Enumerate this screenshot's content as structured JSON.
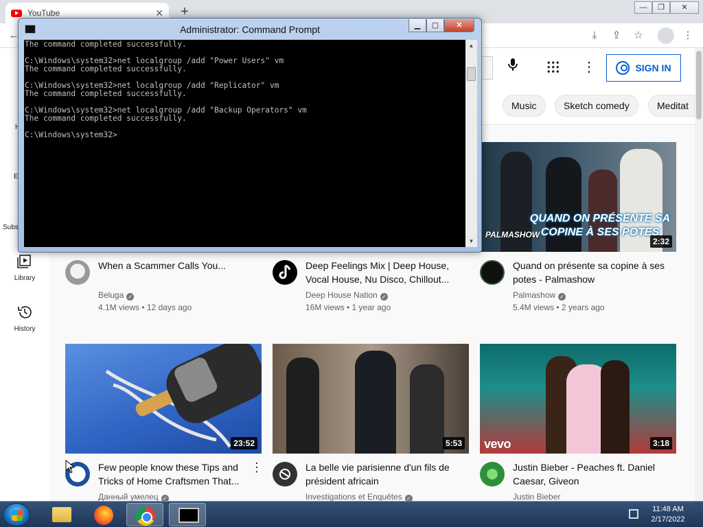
{
  "browser": {
    "tab_title": "YouTube",
    "tab_close": "✕",
    "new_tab": "+"
  },
  "youtube": {
    "sign_in": "SIGN IN",
    "chips": [
      "Music",
      "Sketch comedy",
      "Meditat"
    ],
    "sidebar": [
      {
        "label": "Library",
        "icon": "library-icon"
      },
      {
        "label": "History",
        "icon": "history-icon"
      }
    ],
    "sidebar_cut": {
      "h": "H",
      "e": "E",
      "subs": "Subs"
    },
    "videos": [
      {
        "title": "When a Scammer Calls You...",
        "channel": "Beluga",
        "stats": "4.1M views • 12 days ago",
        "duration": ""
      },
      {
        "title": "Deep Feelings Mix | Deep House, Vocal House, Nu Disco, Chillout...",
        "channel": "Deep House Nation",
        "stats": "16M views • 1 year ago",
        "duration": ""
      },
      {
        "title": "Quand on présente sa copine à ses potes - Palmashow",
        "channel": "Palmashow",
        "stats": "5.4M views • 2 years ago",
        "duration": "2:32",
        "thumb_text": "QUAND ON PRÉSENTE SA COPINE À SES POTES",
        "thumb_logo": "PALMASHOW"
      },
      {
        "title": "Few people know these Tips and Tricks of Home Craftsmen That...",
        "channel": "Данный умелец",
        "stats": "",
        "duration": "23:52"
      },
      {
        "title": "La belle vie parisienne d'un fils de président africain",
        "channel": "Investigations et Enquêtes",
        "stats": "",
        "duration": "5:53"
      },
      {
        "title": "Justin Bieber - Peaches ft. Daniel Caesar, Giveon",
        "channel": "Justin Bieber",
        "stats": "",
        "duration": "3:18",
        "thumb_logo": "vevo"
      }
    ]
  },
  "cmd": {
    "title": "Administrator: Command Prompt",
    "lines": "The command completed successfully.\n\nC:\\Windows\\system32>net localgroup /add \"Power Users\" vm\nThe command completed successfully.\n\nC:\\Windows\\system32>net localgroup /add \"Replicator\" vm\nThe command completed successfully.\n\nC:\\Windows\\system32>net localgroup /add \"Backup Operators\" vm\nThe command completed successfully.\n\nC:\\Windows\\system32>"
  },
  "taskbar": {
    "time": "11:48 AM",
    "date": "2/17/2022"
  }
}
